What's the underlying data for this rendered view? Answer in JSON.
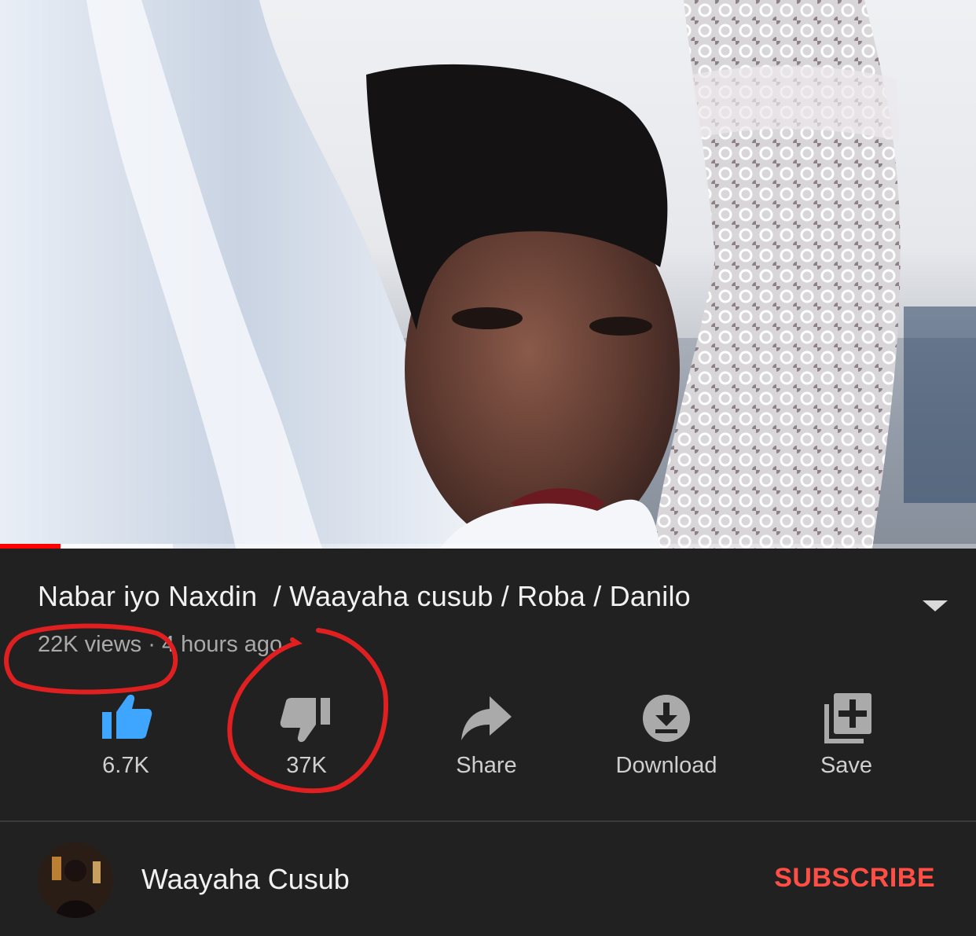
{
  "video": {
    "title": "Nabar iyo Naxdin  / Waayaha cusub / Roba / Danilo",
    "views": "22K views",
    "separator": "·",
    "age": "4 hours ago",
    "progress_played": 0.062,
    "progress_buffered": 0.177
  },
  "actions": {
    "like": {
      "label": "6.7K",
      "icon": "thumbs-up-icon"
    },
    "dislike": {
      "label": "37K",
      "icon": "thumbs-down-icon"
    },
    "share": {
      "label": "Share",
      "icon": "share-arrow-icon"
    },
    "download": {
      "label": "Download",
      "icon": "download-icon"
    },
    "save": {
      "label": "Save",
      "icon": "playlist-add-icon"
    }
  },
  "channel": {
    "name": "Waayaha Cusub",
    "subscribe_label": "SUBSCRIBE"
  },
  "colors": {
    "background": "#212121",
    "like_active": "#3ea6ff",
    "subscribe": "#ff4e45",
    "progress": "#ff0000",
    "annotation": "#e02020"
  }
}
